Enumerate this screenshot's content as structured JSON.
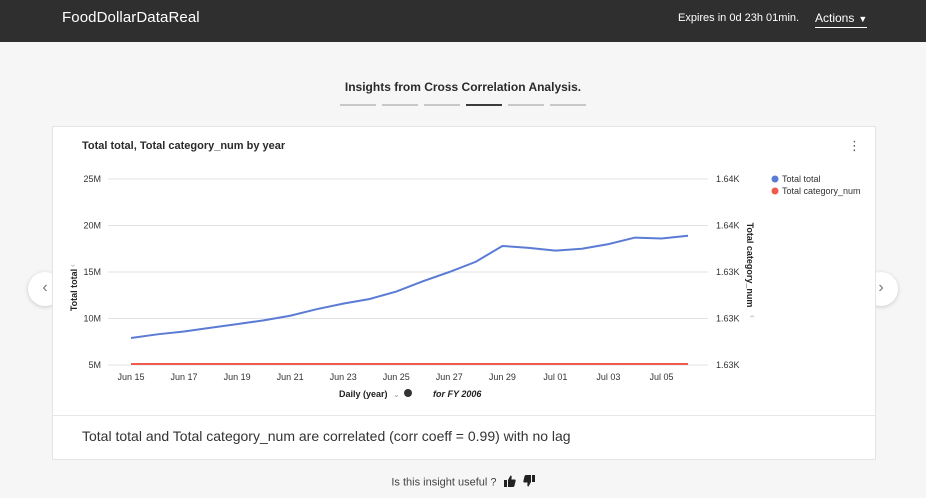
{
  "app": {
    "title": "FoodDollarDataReal"
  },
  "header": {
    "expires": "Expires in 0d 23h 01min.",
    "actions_label": "Actions"
  },
  "insights": {
    "title": "Insights from Cross Correlation Analysis.",
    "step_count": 6,
    "active_step": 3
  },
  "chart_card": {
    "title": "Total total, Total category_num by year",
    "summary": "Total total and Total category_num are correlated (corr coeff = 0.99) with no lag"
  },
  "feedback": {
    "question": "Is this insight useful ?"
  },
  "icons": {
    "more": "more-vertical-icon",
    "prev": "chevron-left-icon",
    "next": "chevron-right-icon",
    "thumbs_up": "thumbs-up-icon",
    "thumbs_down": "thumbs-down-icon",
    "actions_caret": "caret-down-icon",
    "info": "info-icon"
  },
  "colors": {
    "series1": "#5b7bd5",
    "series2": "#ef5b4c",
    "topbar": "#2f2f2f"
  },
  "chart_data": {
    "type": "line",
    "title": "Total total, Total category_num by year",
    "xlabel": "Daily (year)",
    "xlabel_note": "for FY 2006",
    "ylabel": "Total total",
    "y2label": "Total category_num",
    "x_ticks": [
      "Jun 15",
      "Jun 17",
      "Jun 19",
      "Jun 21",
      "Jun 23",
      "Jun 25",
      "Jun 27",
      "Jun 29",
      "Jul 01",
      "Jul 03",
      "Jul 05"
    ],
    "y_ticks": [
      "5M",
      "10M",
      "15M",
      "20M",
      "25M"
    ],
    "y2_ticks": [
      "1.63K",
      "1.63K",
      "1.63K",
      "1.64K",
      "1.64K"
    ],
    "ylim": [
      5000000,
      25000000
    ],
    "x": [
      "Jun 15",
      "Jun 16",
      "Jun 17",
      "Jun 18",
      "Jun 19",
      "Jun 20",
      "Jun 21",
      "Jun 22",
      "Jun 23",
      "Jun 24",
      "Jun 25",
      "Jun 26",
      "Jun 27",
      "Jun 28",
      "Jun 29",
      "Jun 30",
      "Jul 01",
      "Jul 02",
      "Jul 03",
      "Jul 04",
      "Jul 05",
      "Jul 06"
    ],
    "legend_position": "top-right",
    "grid": true,
    "series": [
      {
        "name": "Total total",
        "axis": "left",
        "color": "#5b7bd5",
        "values": [
          7900000,
          8300000,
          8600000,
          9000000,
          9400000,
          9800000,
          10300000,
          11000000,
          11600000,
          12100000,
          12900000,
          14000000,
          15000000,
          16100000,
          17800000,
          17600000,
          17300000,
          17500000,
          18000000,
          18700000,
          18600000,
          18900000
        ]
      },
      {
        "name": "Total category_num",
        "axis": "right",
        "color": "#ef5b4c",
        "values": [
          1630,
          1630,
          1630,
          1630,
          1630,
          1630,
          1630,
          1630,
          1630,
          1630,
          1630,
          1630,
          1630,
          1630,
          1630,
          1630,
          1630,
          1630,
          1630,
          1630,
          1630,
          1630
        ]
      }
    ]
  }
}
